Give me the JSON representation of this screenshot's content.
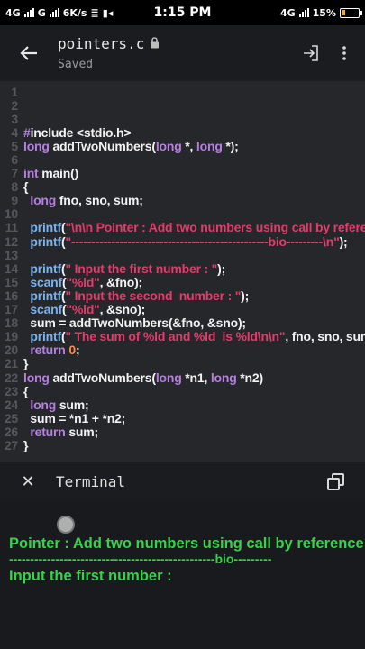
{
  "status_bar": {
    "network_left": "4G",
    "sim2": "G",
    "speed": "6K/s",
    "time": "1:15 PM",
    "network_right": "4G",
    "battery": "15%"
  },
  "toolbar": {
    "file_name": "pointers.c",
    "subtitle": "Saved",
    "lock_icon": "lock-icon",
    "export_icon": "export-icon",
    "menu_icon": "more-vert-icon"
  },
  "editor": {
    "lines": [
      {
        "n": "1",
        "t": ""
      },
      {
        "n": "2",
        "t": ""
      },
      {
        "n": "3",
        "t": ""
      },
      {
        "n": "4",
        "t": "#include <stdio.h>"
      },
      {
        "n": "5",
        "t": "long addTwoNumbers(long *, long *);"
      },
      {
        "n": "6",
        "t": ""
      },
      {
        "n": "7",
        "t": "int main()"
      },
      {
        "n": "8",
        "t": "{"
      },
      {
        "n": "9",
        "t": "  long fno, sno, sum;"
      },
      {
        "n": "10",
        "t": ""
      },
      {
        "n": "11",
        "t": "  printf(\"\\n\\n Pointer : Add two numbers using call by reference:\\n\");"
      },
      {
        "n": "12",
        "t": "  printf(\"-------------------------------------------------bio---------\\n\");"
      },
      {
        "n": "13",
        "t": ""
      },
      {
        "n": "14",
        "t": "  printf(\" Input the first number : \");"
      },
      {
        "n": "15",
        "t": "  scanf(\"%ld\", &fno);"
      },
      {
        "n": "16",
        "t": "  printf(\" Input the second  number : \");"
      },
      {
        "n": "17",
        "t": "  scanf(\"%ld\", &sno);"
      },
      {
        "n": "18",
        "t": "  sum = addTwoNumbers(&fno, &sno);"
      },
      {
        "n": "19",
        "t": "  printf(\" The sum of %ld and %ld  is %ld\\n\\n\", fno, sno, sum);"
      },
      {
        "n": "20",
        "t": "  return 0;"
      },
      {
        "n": "21",
        "t": "}"
      },
      {
        "n": "22",
        "t": "long addTwoNumbers(long *n1, long *n2)"
      },
      {
        "n": "23",
        "t": "{"
      },
      {
        "n": "24",
        "t": "  long sum;"
      },
      {
        "n": "25",
        "t": "  sum = *n1 + *n2;"
      },
      {
        "n": "26",
        "t": "  return sum;"
      },
      {
        "n": "27",
        "t": "}"
      }
    ]
  },
  "terminal": {
    "label": "Terminal",
    "close_icon": "close-icon",
    "window_icon": "windows-icon",
    "output": [
      "Pointer : Add two numbers using call by reference:",
      "-------------------------------------------------bio---------",
      "Input the first number : "
    ]
  },
  "colors": {
    "keyword": "#b57fe0",
    "function": "#7ab4ee",
    "string": "#e23c6b",
    "number": "#ff8a3c",
    "terminal_text": "#37d14b"
  }
}
